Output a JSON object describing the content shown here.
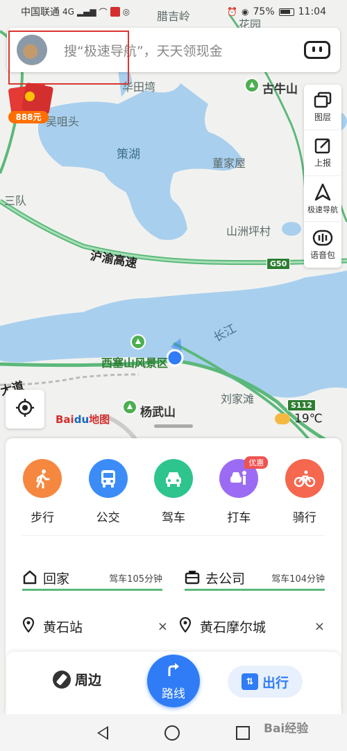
{
  "status_bar": {
    "carrier": "中国联通",
    "network": "4G",
    "battery": "75%",
    "time": "11:04"
  },
  "search": {
    "placeholder": "搜“极速导航”，天天领现金"
  },
  "red_packet": {
    "amount": "888元"
  },
  "right_toolbar": {
    "layers": "图层",
    "report": "上报",
    "fast_nav": "极速导航",
    "voice_pack": "语音包"
  },
  "map": {
    "labels": {
      "labuling": "腊吉岭",
      "huayuan": "花园",
      "huatianwan": "华田塆",
      "guniushan": "古牛山",
      "wuzantou": "吴咀头",
      "cehu": "策湖",
      "dongjiawu": "董家屋",
      "sandui": "三队",
      "shanzhoupingcun": "山洲坪村",
      "hu_yu_highway": "沪渝高速",
      "g50": "G50",
      "changjiang": "长江",
      "xisaishan": "西塞山风景区",
      "liujiatan": "刘家滩",
      "yangwushan": "杨武山",
      "s112": "S112",
      "dadao": "大道"
    },
    "weather": "19℃",
    "baidu_logo_a": "Bai",
    "baidu_logo_b": "du",
    "baidu_logo_c": "地图"
  },
  "transport_modes": [
    {
      "label": "步行",
      "color": "#f5873f"
    },
    {
      "label": "公交",
      "color": "#3b8cf7"
    },
    {
      "label": "驾车",
      "color": "#2ec48d"
    },
    {
      "label": "打车",
      "color": "#9b6cf3",
      "badge": "优惠"
    },
    {
      "label": "骑行",
      "color": "#f5674e"
    }
  ],
  "shortcuts": {
    "home": {
      "title": "回家",
      "eta": "驾车105分钟"
    },
    "work": {
      "title": "去公司",
      "eta": "驾车104分钟"
    }
  },
  "recent": [
    {
      "name": "黄石站",
      "close": "×"
    },
    {
      "name": "黄石摩尔城",
      "close": "×"
    }
  ],
  "tab_bar": {
    "nearby": "周边",
    "route": "路线",
    "travel": "出行"
  },
  "watermark": "Bai经验",
  "colors": {
    "accent": "#2f7cf6",
    "highlight": "#d9362e",
    "road_green": "#5cb87a",
    "water": "#a9cfee"
  }
}
